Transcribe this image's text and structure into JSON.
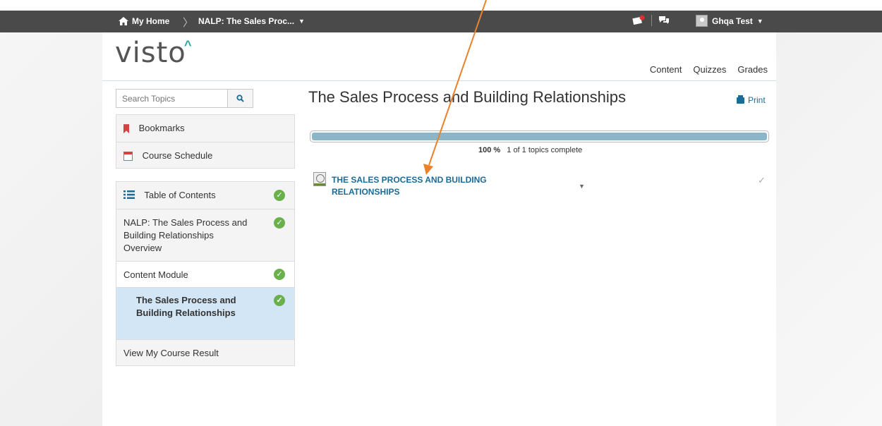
{
  "navbar": {
    "home_label": "My Home",
    "separator": "〉",
    "course_label": "NALP: The Sales Proc...",
    "user_name": "Ghqa Test"
  },
  "logo": {
    "text": "visto",
    "accent": "^"
  },
  "tabs": [
    "Content",
    "Quizzes",
    "Grades"
  ],
  "search": {
    "placeholder": "Search Topics"
  },
  "sidebar": {
    "bookmarks": "Bookmarks",
    "schedule": "Course Schedule",
    "toc": "Table of Contents",
    "overview": "NALP: The Sales Process and Building Relationships Overview",
    "module": "Content Module",
    "topic": "The Sales Process and Building Relationships",
    "result": "View My Course Result"
  },
  "main": {
    "title": "The Sales Process and Building Relationships",
    "print_label": "Print",
    "progress_percent": "100 %",
    "progress_value": 1.0,
    "progress_text": "1 of 1 topics complete",
    "topic_title": "THE SALES PROCESS AND BUILDING RELATIONSHIPS",
    "topic_complete_mark": "✓"
  },
  "colors": {
    "navbar": "#4a4a4a",
    "link": "#1b6b99",
    "logo_accent": "#2aa4a0",
    "active_row": "#d3e6f5",
    "check": "#6ab04c",
    "progress_fill": "#8ab6c8",
    "annotation_arrow": "#e8822b"
  }
}
